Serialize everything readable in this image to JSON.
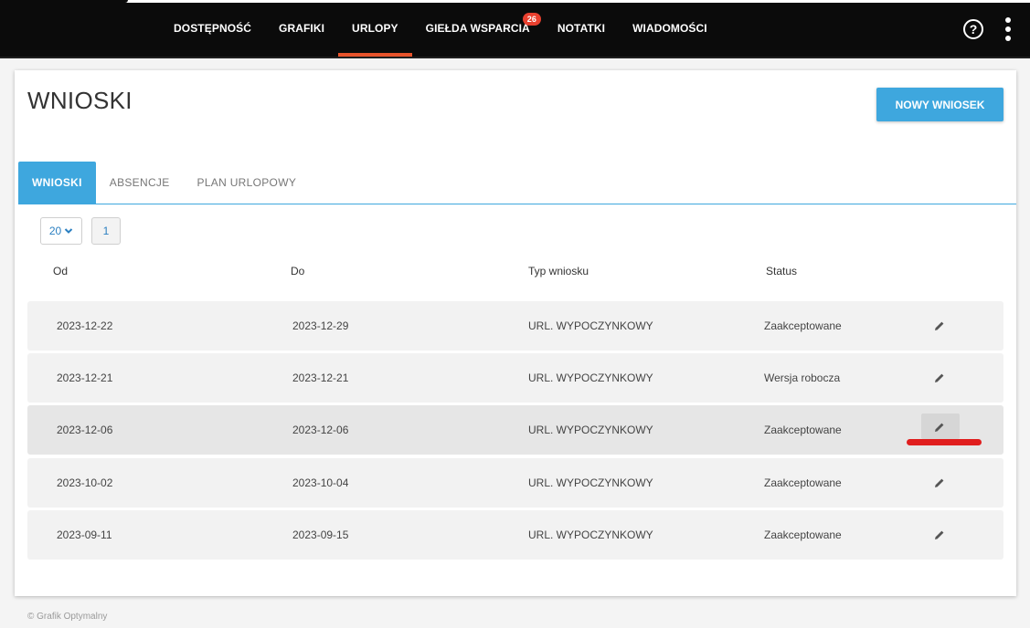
{
  "nav": {
    "items": [
      {
        "label": "DOSTĘPNOŚĆ"
      },
      {
        "label": "GRAFIKI"
      },
      {
        "label": "URLOPY"
      },
      {
        "label": "GIEŁDA WSPARCIA",
        "badge": "26"
      },
      {
        "label": "NOTATKI"
      },
      {
        "label": "WIADOMOŚCI"
      }
    ],
    "help_symbol": "?"
  },
  "page": {
    "title": "WNIOSKI",
    "new_button": "NOWY WNIOSEK"
  },
  "tabs": [
    "WNIOSKI",
    "ABSENCJE",
    "PLAN URLOPOWY"
  ],
  "pagination": {
    "page_size": "20",
    "current_page": "1"
  },
  "table": {
    "headers": [
      "Od",
      "Do",
      "Typ wniosku",
      "Status"
    ],
    "rows": [
      [
        "2023-12-22",
        "2023-12-29",
        "URL. WYPOCZYNKOWY",
        "Zaakceptowane"
      ],
      [
        "2023-12-21",
        "2023-12-21",
        "URL. WYPOCZYNKOWY",
        "Wersja robocza"
      ],
      [
        "2023-12-06",
        "2023-12-06",
        "URL. WYPOCZYNKOWY",
        "Zaakceptowane"
      ],
      [
        "2023-10-02",
        "2023-10-04",
        "URL. WYPOCZYNKOWY",
        "Zaakceptowane"
      ],
      [
        "2023-09-11",
        "2023-09-15",
        "URL. WYPOCZYNKOWY",
        "Zaakceptowane"
      ]
    ]
  },
  "footer": "© Grafik Optymalny",
  "colors": {
    "accent": "#3ea7de",
    "nav_active": "#e8532b",
    "badge": "#e8402f",
    "annotation": "#e01e1e"
  }
}
